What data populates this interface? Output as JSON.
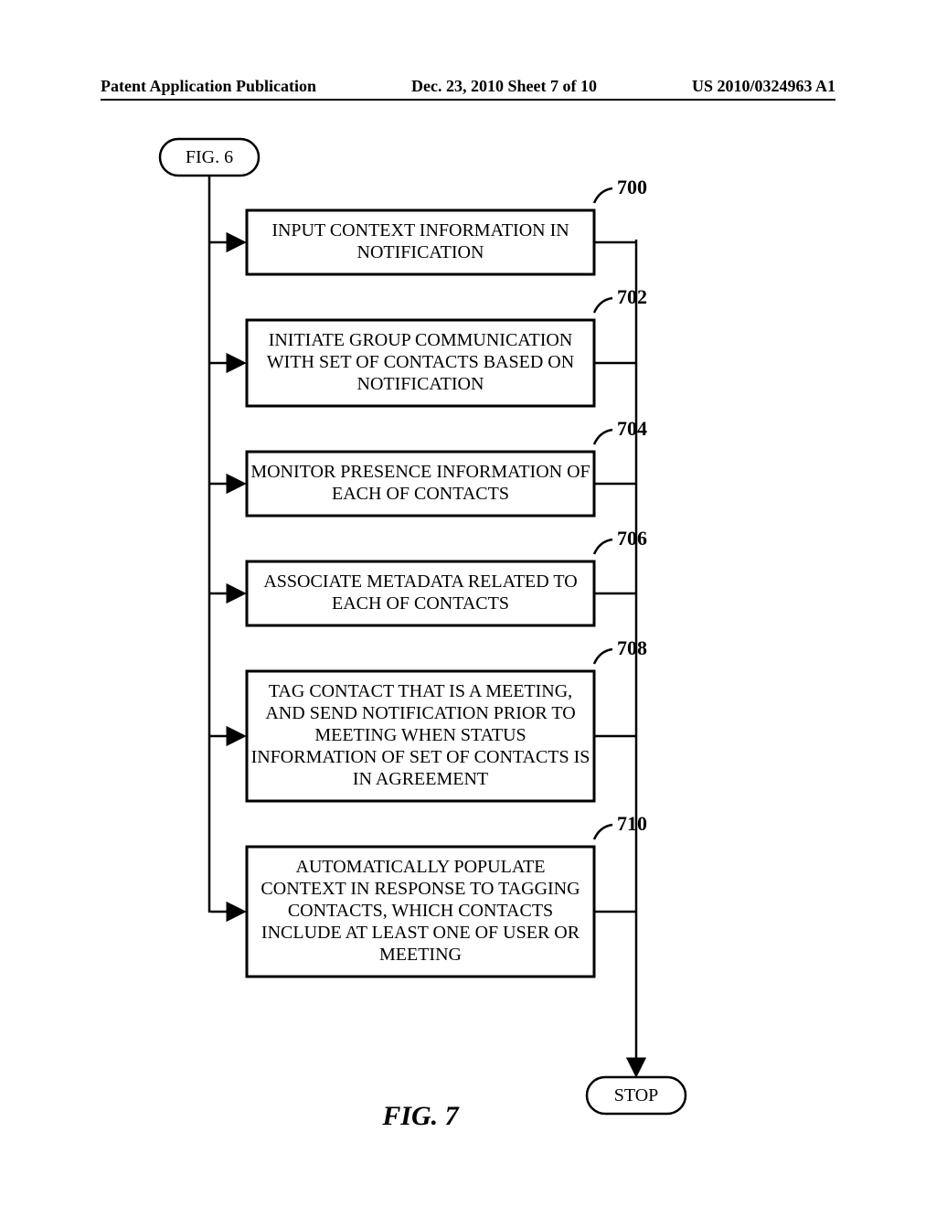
{
  "header": {
    "left": "Patent Application Publication",
    "center": "Dec. 23, 2010  Sheet 7 of 10",
    "right": "US 2010/0324963 A1"
  },
  "connector": {
    "from_label": "FIG. 6"
  },
  "steps": [
    {
      "ref": "700",
      "lines": [
        "INPUT CONTEXT INFORMATION IN",
        "NOTIFICATION"
      ]
    },
    {
      "ref": "702",
      "lines": [
        "INITIATE GROUP COMMUNICATION",
        "WITH SET OF CONTACTS BASED ON",
        "NOTIFICATION"
      ]
    },
    {
      "ref": "704",
      "lines": [
        "MONITOR PRESENCE INFORMATION OF",
        "EACH OF CONTACTS"
      ]
    },
    {
      "ref": "706",
      "lines": [
        "ASSOCIATE METADATA RELATED TO",
        "EACH OF CONTACTS"
      ]
    },
    {
      "ref": "708",
      "lines": [
        "TAG CONTACT THAT IS A MEETING,",
        "AND SEND NOTIFICATION PRIOR TO",
        "MEETING WHEN STATUS",
        "INFORMATION OF SET OF CONTACTS IS",
        "IN AGREEMENT"
      ]
    },
    {
      "ref": "710",
      "lines": [
        "AUTOMATICALLY POPULATE",
        "CONTEXT IN RESPONSE TO TAGGING",
        "CONTACTS, WHICH CONTACTS",
        "INCLUDE AT LEAST ONE OF USER OR",
        "MEETING"
      ]
    }
  ],
  "terminator": {
    "label": "STOP"
  },
  "caption": "FIG. 7",
  "chart_data": {
    "type": "flowchart",
    "title": "FIG. 7",
    "entry": {
      "type": "off-page-connector",
      "label": "FIG. 6"
    },
    "nodes": [
      {
        "id": "700",
        "type": "process",
        "text": "INPUT CONTEXT INFORMATION IN NOTIFICATION"
      },
      {
        "id": "702",
        "type": "process",
        "text": "INITIATE GROUP COMMUNICATION WITH SET OF CONTACTS BASED ON NOTIFICATION"
      },
      {
        "id": "704",
        "type": "process",
        "text": "MONITOR PRESENCE INFORMATION OF EACH OF CONTACTS"
      },
      {
        "id": "706",
        "type": "process",
        "text": "ASSOCIATE METADATA RELATED TO EACH OF CONTACTS"
      },
      {
        "id": "708",
        "type": "process",
        "text": "TAG CONTACT THAT IS A MEETING, AND SEND NOTIFICATION PRIOR TO MEETING WHEN STATUS INFORMATION OF SET OF CONTACTS IS IN AGREEMENT"
      },
      {
        "id": "710",
        "type": "process",
        "text": "AUTOMATICALLY POPULATE CONTEXT IN RESPONSE TO TAGGING CONTACTS, WHICH CONTACTS INCLUDE AT LEAST ONE OF USER OR MEETING"
      },
      {
        "id": "stop",
        "type": "terminator",
        "text": "STOP"
      }
    ],
    "edges": [
      {
        "from": "entry",
        "to": "700",
        "style": "left-bus"
      },
      {
        "from": "entry",
        "to": "702",
        "style": "left-bus"
      },
      {
        "from": "entry",
        "to": "704",
        "style": "left-bus"
      },
      {
        "from": "entry",
        "to": "706",
        "style": "left-bus"
      },
      {
        "from": "entry",
        "to": "708",
        "style": "left-bus"
      },
      {
        "from": "entry",
        "to": "710",
        "style": "left-bus"
      },
      {
        "from": "700",
        "to": "stop",
        "style": "right-bus"
      },
      {
        "from": "702",
        "to": "stop",
        "style": "right-bus"
      },
      {
        "from": "704",
        "to": "stop",
        "style": "right-bus"
      },
      {
        "from": "706",
        "to": "stop",
        "style": "right-bus"
      },
      {
        "from": "708",
        "to": "stop",
        "style": "right-bus"
      },
      {
        "from": "710",
        "to": "stop",
        "style": "right-bus"
      }
    ]
  }
}
